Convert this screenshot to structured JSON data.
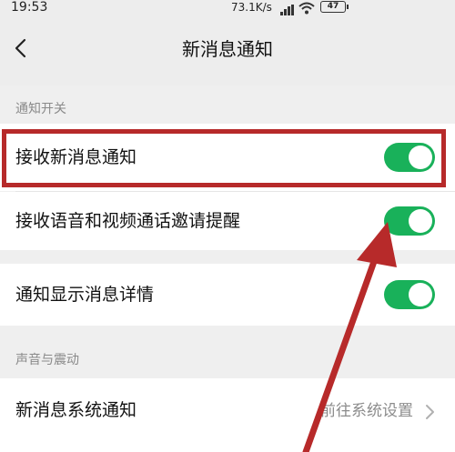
{
  "status_bar": {
    "time": "19:53",
    "net_speed": "73.1K/s",
    "battery": "47",
    "signal_icon": "signal-icon",
    "wifi_icon": "wifi-icon"
  },
  "nav": {
    "title": "新消息通知",
    "back_icon": "chevron-left-icon"
  },
  "sections": [
    {
      "label": "通知开关"
    },
    {
      "label": "声音与震动"
    }
  ],
  "rows": {
    "receive_new": {
      "label": "接收新消息通知",
      "on": true
    },
    "voice_video": {
      "label": "接收语音和视频通话邀请提醒",
      "on": true
    },
    "show_details": {
      "label": "通知显示消息详情",
      "on": true
    },
    "system_notification": {
      "label": "新消息系统通知",
      "value": "前往系统设置"
    }
  },
  "colors": {
    "toggle_on": "#19b15a",
    "highlight": "#b72a2a",
    "background": "#efefef"
  }
}
